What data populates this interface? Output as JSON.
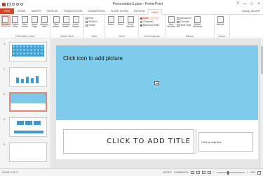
{
  "window": {
    "title": "Presentation1.pptx - PowerPoint",
    "controls": [
      "?",
      "—",
      "□",
      "×"
    ]
  },
  "tabs": [
    {
      "label": "FILE"
    },
    {
      "label": "HOME"
    },
    {
      "label": "INSERT"
    },
    {
      "label": "DESIGN"
    },
    {
      "label": "TRANSITIONS"
    },
    {
      "label": "ANIMATIONS"
    },
    {
      "label": "SLIDE SHOW"
    },
    {
      "label": "REVIEW"
    },
    {
      "label": "VIEW"
    }
  ],
  "active_tab": "VIEW",
  "account": "Young, Scott ▾",
  "ribbon": {
    "presentation_views": {
      "label": "Presentation Views",
      "buttons": [
        "Normal",
        "Outline View",
        "Slide Sorter",
        "Notes Page",
        "Reading View"
      ]
    },
    "master_views": {
      "label": "Master Views",
      "buttons": [
        "Slide Master",
        "Handout Master",
        "Notes Master"
      ]
    },
    "show": {
      "label": "Show",
      "items": [
        "Ruler",
        "Gridlines",
        "Guides"
      ]
    },
    "zoom": {
      "label": "Zoom",
      "buttons": [
        "Notes",
        "Zoom",
        "Fit to Window"
      ]
    },
    "color": {
      "label": "Color/Grayscale",
      "items": [
        "Color",
        "Grayscale",
        "Black and White"
      ]
    },
    "window": {
      "label": "Window",
      "new_window": "New Window",
      "items": [
        "Arrange All",
        "Cascade",
        "Move Split"
      ],
      "switch": "Switch Windows"
    },
    "macros": {
      "label": "Macros",
      "button": "Macros"
    }
  },
  "slides": [
    {
      "number": "1"
    },
    {
      "number": "2"
    },
    {
      "number": "3"
    },
    {
      "number": "4"
    },
    {
      "number": "5"
    }
  ],
  "active_slide": 3,
  "slide": {
    "picture_placeholder": "Click icon to add picture",
    "title_placeholder": "CLICK TO ADD TITLE",
    "text_placeholder": "Click to add text"
  },
  "status": {
    "slide_counter": "SLIDE 3 OF 5",
    "notes": "NOTES",
    "comments": "COMMENTS",
    "zoom": "79%",
    "zoom_level": 0.79
  },
  "colors": {
    "accent": "#d24726",
    "placeholder_blue": "#7ecbec"
  }
}
